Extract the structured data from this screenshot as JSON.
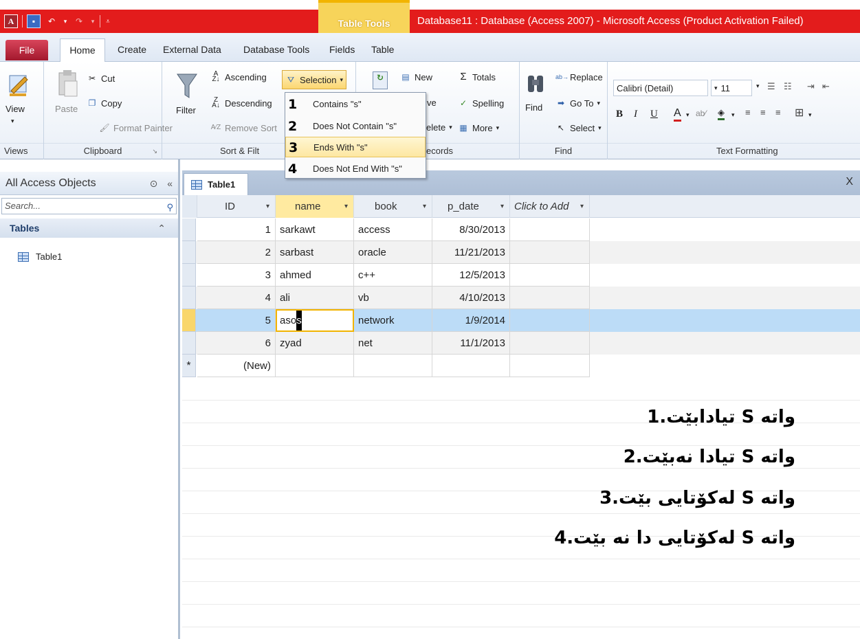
{
  "title_bar": {
    "contextual_tab": "Table Tools",
    "window_title": "Database11 : Database (Access 2007)  -  Microsoft Access (Product Activation Failed)"
  },
  "ribbon_tabs": [
    "File",
    "Home",
    "Create",
    "External Data",
    "Database Tools",
    "Fields",
    "Table"
  ],
  "ribbon": {
    "views": {
      "view": "View",
      "label": "Views"
    },
    "clipboard": {
      "paste": "Paste",
      "cut": "Cut",
      "copy": "Copy",
      "format_painter": "Format Painter",
      "label": "Clipboard"
    },
    "sort_filter": {
      "filter": "Filter",
      "ascending": "Ascending",
      "descending": "Descending",
      "remove_sort": "Remove Sort",
      "selection": "Selection",
      "label": "Sort & Filt"
    },
    "records": {
      "new": "New",
      "save": "ve",
      "delete": "elete",
      "totals": "Totals",
      "spelling": "Spelling",
      "more": "More",
      "label": "ecords"
    },
    "find": {
      "find": "Find",
      "replace": "Replace",
      "goto": "Go To",
      "select": "Select",
      "label": "Find"
    },
    "text_formatting": {
      "font": "Calibri (Detail)",
      "size": "11",
      "bold": "B",
      "italic": "I",
      "underline": "U",
      "font_color": "A",
      "label": "Text Formatting"
    }
  },
  "selection_menu": {
    "items": [
      {
        "num": "1",
        "label": "Contains \"s\""
      },
      {
        "num": "2",
        "label": "Does Not Contain \"s\""
      },
      {
        "num": "3",
        "label": "Ends With \"s\""
      },
      {
        "num": "4",
        "label": "Does Not End With \"s\""
      }
    ]
  },
  "nav_pane": {
    "header": "All Access Objects",
    "search_placeholder": "Search...",
    "group": "Tables",
    "items": [
      "Table1"
    ]
  },
  "document_tab": "Table1",
  "close_glyph": "X",
  "datasheet": {
    "columns": [
      "ID",
      "name",
      "book",
      "p_date",
      "Click to Add"
    ],
    "rows": [
      {
        "id": "1",
        "name": "sarkawt",
        "book": "access",
        "p_date": "8/30/2013"
      },
      {
        "id": "2",
        "name": "sarbast",
        "book": "oracle",
        "p_date": "11/21/2013"
      },
      {
        "id": "3",
        "name": "ahmed",
        "book": "c++",
        "p_date": "12/5/2013"
      },
      {
        "id": "4",
        "name": "ali",
        "book": "vb",
        "p_date": "4/10/2013"
      },
      {
        "id": "5",
        "name_prefix": "aso",
        "name_caret": "s",
        "book": "network",
        "p_date": "1/9/2014"
      },
      {
        "id": "6",
        "name": "zyad",
        "book": "net",
        "p_date": "11/1/2013"
      }
    ],
    "new_row_marker": "*",
    "new_row_label": "(New)"
  },
  "notes": [
    "واته S  تیادابێت.1",
    "واته  S  تیادا نەبێت.2",
    "واته S  لەکۆتایی بێت.3",
    "واته S  لەکۆتایی دا نە بێت.4"
  ]
}
